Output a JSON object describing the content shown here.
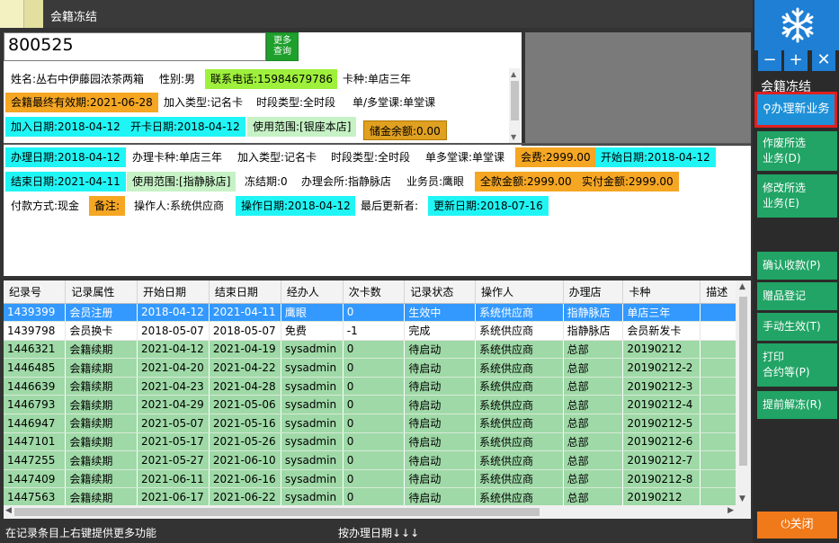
{
  "window": {
    "title": "会籍冻结"
  },
  "search": {
    "member_id": "800525",
    "more_label": "更多",
    "more_label2": "查询"
  },
  "info_tags": [
    "姓名:丛右中伊藤园浓茶两箱",
    "性别:男",
    "联系电话:15984679786",
    "卡种:单店三年",
    "会籍最终有效期:2021-06-28",
    "加入类型:记名卡",
    "时段类型:全时段",
    "单/多堂课:单堂课",
    "加入日期:2018-04-12",
    "开卡日期:2018-04-12",
    "使用范围:[银座本店]",
    "储金余额:0.00"
  ],
  "biz_tags": [
    "办理日期:2018-04-12",
    "办理卡种:单店三年",
    "加入类型:记名卡",
    "时段类型:全时段",
    "单多堂课:单堂课",
    "会费:2999.00",
    "开始日期:2018-04-12",
    "结束日期:2021-04-11",
    "使用范围:[指静脉店]",
    "冻结期:0",
    "办理会所:指静脉店",
    "业务员:鹰眼",
    "全款金额:2999.00",
    "实付金额:2999.00",
    "付款方式:现金",
    "备注:",
    "操作人:系统供应商",
    "操作日期:2018-04-12",
    "最后更新者:",
    "更新日期:2018-07-16"
  ],
  "grid": {
    "columns": [
      "纪录号",
      "记录属性",
      "开始日期",
      "结束日期",
      "经办人",
      "次卡数",
      "记录状态",
      "操作人",
      "办理店",
      "卡种",
      "描述"
    ],
    "rows": [
      [
        "1439399",
        "会员注册",
        "2018-04-12",
        "2021-04-11",
        "鹰眼",
        "0",
        "生效中",
        "系统供应商",
        "指静脉店",
        "单店三年",
        ""
      ],
      [
        "1439798",
        "会员换卡",
        "2018-05-07",
        "2018-05-07",
        "免费",
        "-1",
        "完成",
        "系统供应商",
        "指静脉店",
        "会员新发卡",
        ""
      ],
      [
        "1446321",
        "会籍续期",
        "2021-04-12",
        "2021-04-19",
        "sysadmin",
        "0",
        "待启动",
        "系统供应商",
        "总部",
        "20190212",
        ""
      ],
      [
        "1446485",
        "会籍续期",
        "2021-04-20",
        "2021-04-22",
        "sysadmin",
        "0",
        "待启动",
        "系统供应商",
        "总部",
        "20190212-2",
        ""
      ],
      [
        "1446639",
        "会籍续期",
        "2021-04-23",
        "2021-04-28",
        "sysadmin",
        "0",
        "待启动",
        "系统供应商",
        "总部",
        "20190212-3",
        ""
      ],
      [
        "1446793",
        "会籍续期",
        "2021-04-29",
        "2021-05-06",
        "sysadmin",
        "0",
        "待启动",
        "系统供应商",
        "总部",
        "20190212-4",
        ""
      ],
      [
        "1446947",
        "会籍续期",
        "2021-05-07",
        "2021-05-16",
        "sysadmin",
        "0",
        "待启动",
        "系统供应商",
        "总部",
        "20190212-5",
        ""
      ],
      [
        "1447101",
        "会籍续期",
        "2021-05-17",
        "2021-05-26",
        "sysadmin",
        "0",
        "待启动",
        "系统供应商",
        "总部",
        "20190212-6",
        ""
      ],
      [
        "1447255",
        "会籍续期",
        "2021-05-27",
        "2021-06-10",
        "sysadmin",
        "0",
        "待启动",
        "系统供应商",
        "总部",
        "20190212-7",
        ""
      ],
      [
        "1447409",
        "会籍续期",
        "2021-06-11",
        "2021-06-16",
        "sysadmin",
        "0",
        "待启动",
        "系统供应商",
        "总部",
        "20190212-8",
        ""
      ],
      [
        "1447563",
        "会籍续期",
        "2021-06-17",
        "2021-06-22",
        "sysadmin",
        "0",
        "待启动",
        "系统供应商",
        "总部",
        "20190212",
        ""
      ]
    ]
  },
  "status": {
    "hint": "在记录条目上右键提供更多功能",
    "sort": "按办理日期↓↓↓"
  },
  "sidebar": {
    "title": "会籍冻结",
    "new_business": "办理新业务",
    "void_1": "作废所选",
    "void_2": "业务(D)",
    "edit_1": "修改所选",
    "edit_2": "业务(E)",
    "confirm": "确认收款(P)",
    "gift": "赠品登记",
    "manual": "手动生效(T)",
    "print_1": "打印",
    "print_2": "合约等(P)",
    "unfreeze": "提前解冻(R)",
    "close": "关闭"
  },
  "colors": {
    "accent_blue": "#1e7fd4",
    "sidebar_green": "#21a465",
    "row_green": "#9fd9a7",
    "selected": "#3399ff",
    "close_orange": "#f07a1a"
  }
}
